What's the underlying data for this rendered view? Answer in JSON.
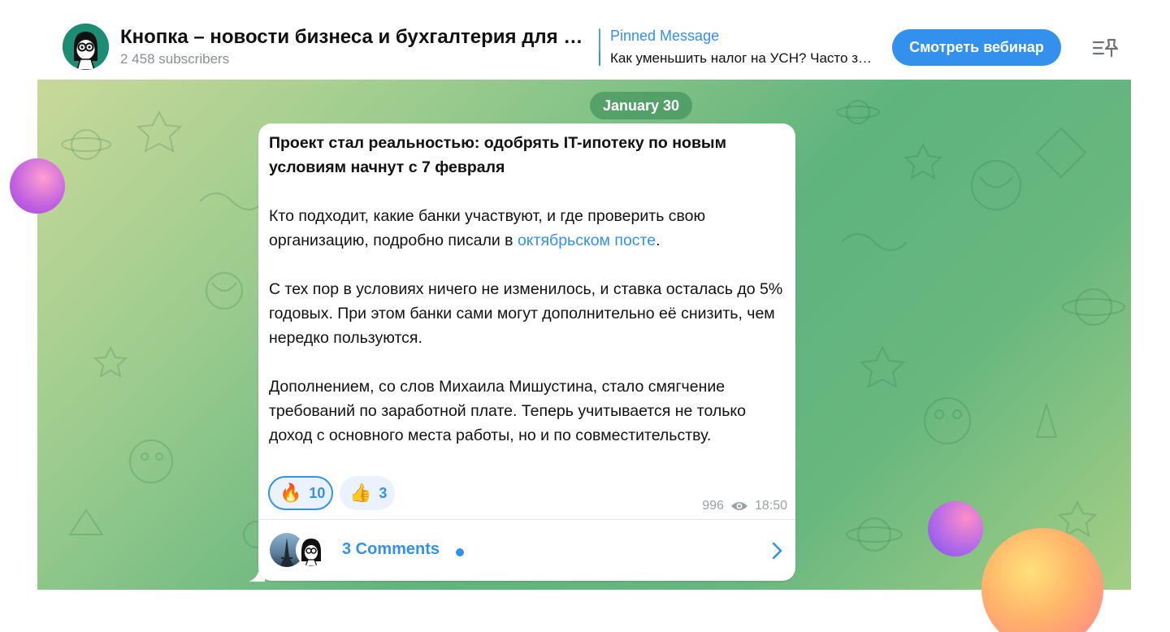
{
  "header": {
    "channel_title": "Кнопка – новости бизнеса и бухгалтерия для предпринимателей",
    "subscribers": "2 458 subscribers",
    "pinned": {
      "label": "Pinned Message",
      "text": "Как уменьшить налог на УСН? Часто задаваемые вопросы"
    },
    "webinar_button": "Смотреть вебинар",
    "icons": {
      "avatar": "channel-avatar",
      "pinned_list": "pinned-messages-icon"
    }
  },
  "chat": {
    "date_label": "January 30",
    "message": {
      "title": "Проект стал реальностью: одобрять IT-ипотеку по новым условиям начнут с 7 февраля",
      "p1_before_link": "Кто подходит, какие банки участвуют, и где проверить свою организацию, подробно писали в ",
      "p1_link": "октябрьском посте",
      "p1_after_link": ".",
      "p2": "С тех пор в условиях ничего не изменилось, и ставка осталась до 5% годовых. При этом банки сами могут дополнительно её снизить, чем нередко пользуются.",
      "p3": "Дополнением, со слов Михаила Мишустина, стало смягчение требований по заработной плате. Теперь учитывается не только доход с основного места работы, но и по совместительству.",
      "reactions": [
        {
          "emoji": "🔥",
          "count": "10",
          "active": true
        },
        {
          "emoji": "👍",
          "count": "3",
          "active": false
        }
      ],
      "views": "996",
      "time": "18:50",
      "comments_label": "3 Comments"
    }
  },
  "colors": {
    "accent": "#3390ec",
    "date_pill": "#46965f"
  }
}
